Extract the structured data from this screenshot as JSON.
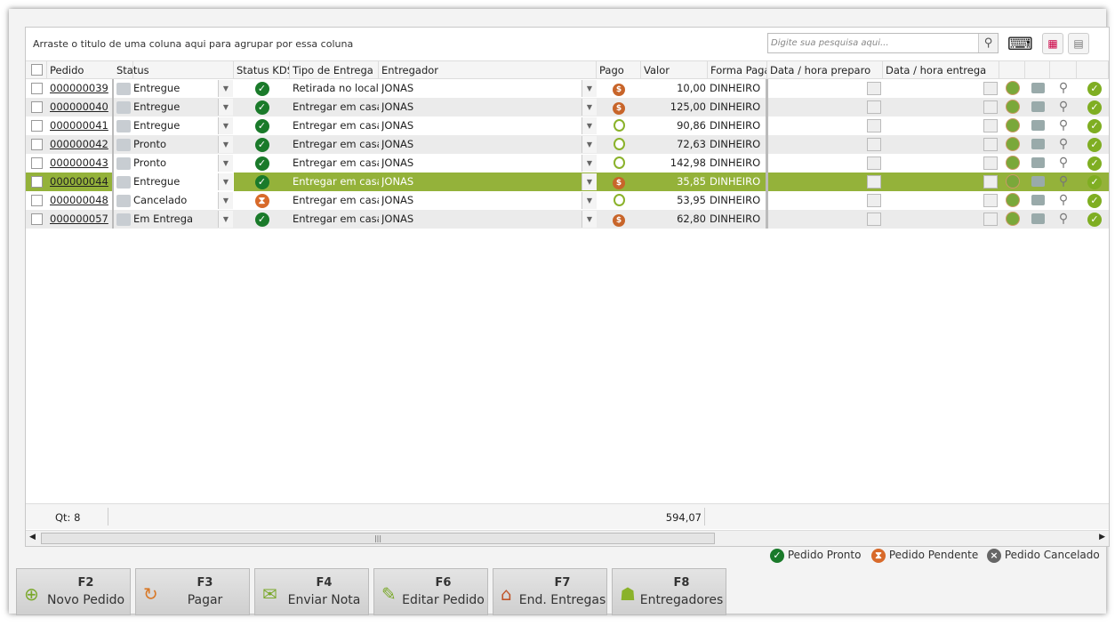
{
  "toolbar": {
    "group_hint": "Arraste o titulo de uma coluna aqui para agrupar por essa coluna",
    "search_placeholder": "Digite sua pesquisa aqui..."
  },
  "columns": [
    "Pedido",
    "Status",
    "Status KDS",
    "Tipo de Entrega",
    "Entregador",
    "Pago",
    "Valor",
    "Forma Paga",
    "Data / hora preparo",
    "Data / hora entrega"
  ],
  "rows": [
    {
      "pedido": "000000039",
      "status": "Entregue",
      "kds": "ok",
      "tipo": "Retirada no local",
      "entregador": "JONAS",
      "pago": "coin",
      "valor": "10,00",
      "forma": "DINHEIRO"
    },
    {
      "pedido": "000000040",
      "status": "Entregue",
      "kds": "ok",
      "tipo": "Entregar em casa",
      "entregador": "JONAS",
      "pago": "coin",
      "valor": "125,00",
      "forma": "DINHEIRO"
    },
    {
      "pedido": "000000041",
      "status": "Entregue",
      "kds": "ok",
      "tipo": "Entregar em casa",
      "entregador": "JONAS",
      "pago": "card",
      "valor": "90,86",
      "forma": "DINHEIRO"
    },
    {
      "pedido": "000000042",
      "status": "Pronto",
      "kds": "ok",
      "tipo": "Entregar em casa",
      "entregador": "JONAS",
      "pago": "card",
      "valor": "72,63",
      "forma": "DINHEIRO"
    },
    {
      "pedido": "000000043",
      "status": "Pronto",
      "kds": "ok",
      "tipo": "Entregar em casa",
      "entregador": "JONAS",
      "pago": "card",
      "valor": "142,98",
      "forma": "DINHEIRO"
    },
    {
      "pedido": "000000044",
      "status": "Entregue",
      "kds": "ok",
      "tipo": "Entregar em casa",
      "entregador": "JONAS",
      "pago": "coin",
      "valor": "35,85",
      "forma": "DINHEIRO"
    },
    {
      "pedido": "000000048",
      "status": "Cancelado",
      "kds": "pend",
      "tipo": "Entregar em casa",
      "entregador": "JONAS",
      "pago": "card",
      "valor": "53,95",
      "forma": "DINHEIRO"
    },
    {
      "pedido": "000000057",
      "status": "Em Entrega",
      "kds": "ok",
      "tipo": "Entregar em casa",
      "entregador": "JONAS",
      "pago": "coin",
      "valor": "62,80",
      "forma": "DINHEIRO"
    }
  ],
  "selected_row": 5,
  "footer": {
    "count": "Qt: 8",
    "total": "594,07"
  },
  "legend": {
    "pronto": "Pedido Pronto",
    "pendente": "Pedido Pendente",
    "cancelado": "Pedido Cancelado"
  },
  "buttons": [
    {
      "key": "F2",
      "label": "Novo Pedido",
      "icon": "plus-icon"
    },
    {
      "key": "F3",
      "label": "Pagar",
      "icon": "pay-icon"
    },
    {
      "key": "F4",
      "label": "Enviar Nota",
      "icon": "send-invoice-icon"
    },
    {
      "key": "F6",
      "label": "Editar Pedido",
      "icon": "edit-icon"
    },
    {
      "key": "F7",
      "label": "End. Entregas",
      "icon": "house-icon"
    },
    {
      "key": "F8",
      "label": "Entregadores",
      "icon": "courier-icon"
    }
  ]
}
